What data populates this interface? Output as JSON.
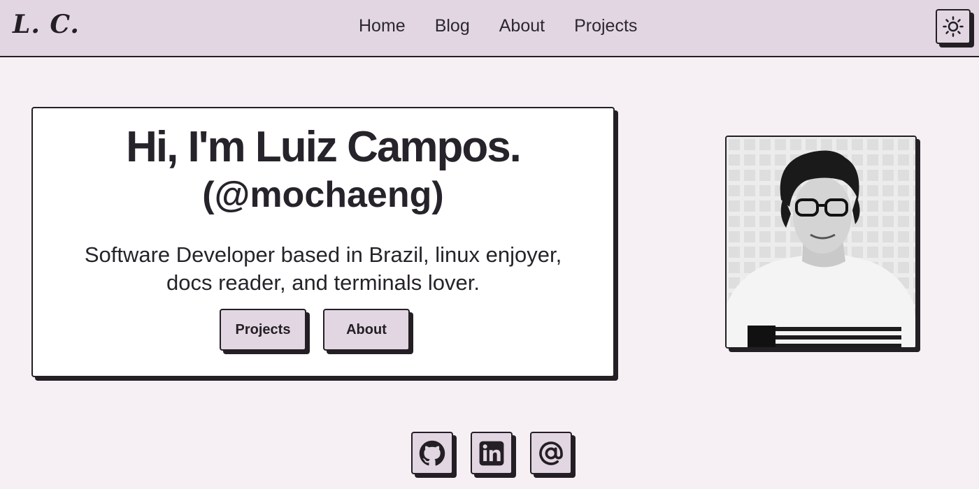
{
  "header": {
    "logo": "L. C.",
    "nav": [
      {
        "label": "Home"
      },
      {
        "label": "Blog"
      },
      {
        "label": "About"
      },
      {
        "label": "Projects"
      }
    ],
    "theme_toggle_icon": "sun-icon"
  },
  "hero": {
    "title": "Hi, I'm Luiz Campos.",
    "handle": "(@mochaeng)",
    "description": "Software Developer based in Brazil, linux enjoyer, docs reader, and terminals lover.",
    "buttons": {
      "projects": "Projects",
      "about": "About"
    }
  },
  "profile_photo": {
    "icon": "profile-photo"
  },
  "socials": [
    {
      "icon": "github-icon"
    },
    {
      "icon": "linkedin-icon"
    },
    {
      "icon": "email-at-icon"
    }
  ],
  "colors": {
    "background": "#f6f0f5",
    "header": "#e2d6e2",
    "border": "#231f24",
    "card": "#ffffff",
    "text": "#26232a"
  }
}
